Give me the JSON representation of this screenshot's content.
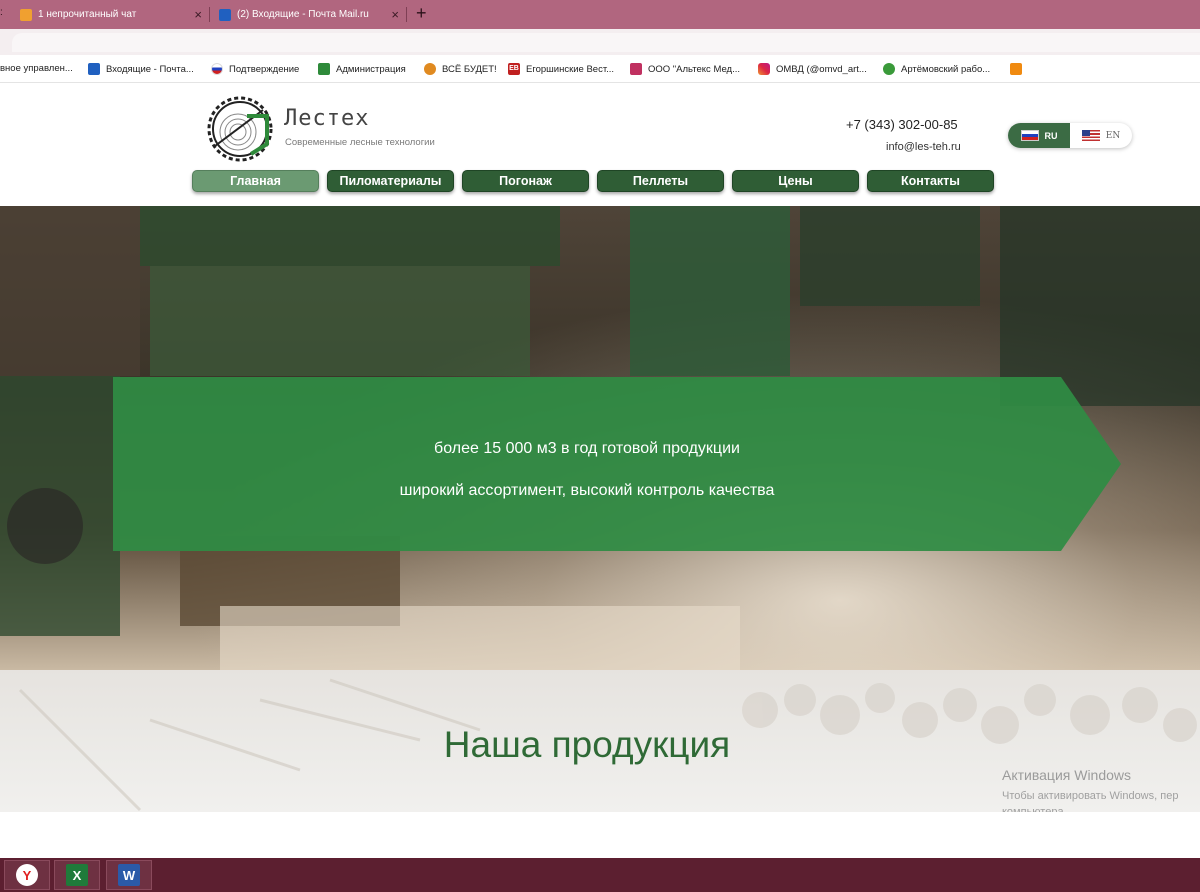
{
  "browser": {
    "cut_tab_glyph": ":",
    "tabs": [
      {
        "title": "1 непрочитанный чат",
        "icon": "mail-orange-icon",
        "color": "#f0a030"
      },
      {
        "title": "(2) Входящие - Почта Mail.ru",
        "icon": "mail-blue-icon",
        "color": "#2060c0"
      }
    ],
    "close_glyph": "×",
    "new_tab_glyph": "+",
    "bookmarks": [
      {
        "label": "вное управлен...",
        "icon": ""
      },
      {
        "label": "Входящие - Почта...",
        "icon": "mail-icon",
        "color": "#2060c0"
      },
      {
        "label": "Подтверждение",
        "icon": "russia-icon",
        "color": "#d02020"
      },
      {
        "label": "Администрация",
        "icon": "shield-icon",
        "color": "#2e8a3a"
      },
      {
        "label": "ВСЁ БУДЕТ!",
        "icon": "coin-icon",
        "color": "#e08a20"
      },
      {
        "label": "Егоршинские Вест...",
        "icon": "eb-icon",
        "color": "#c02020",
        "text": "EB"
      },
      {
        "label": "ООО \"Альтекс Мед...",
        "icon": "med-icon",
        "color": "#c03060"
      },
      {
        "label": "ОМВД (@omvd_art...",
        "icon": "instagram-icon",
        "color": "#c13584"
      },
      {
        "label": "Артёмовский рабо...",
        "icon": "leaf-icon",
        "color": "#3a9a3a"
      },
      {
        "label": "",
        "icon": "ok-icon",
        "color": "#f08a10"
      }
    ]
  },
  "site": {
    "logo_title": "Лестех",
    "logo_subtitle": "Современные лесные технологии",
    "phone": "+7 (343) 302-00-85",
    "email": "info@les-teh.ru",
    "lang": {
      "ru": "RU",
      "en": "EN"
    },
    "nav": [
      "Главная",
      "Пиломатериалы",
      "Погонаж",
      "Пеллеты",
      "Цены",
      "Контакты"
    ],
    "hero": {
      "line1": "более 15 000 м3 в год готовой продукции",
      "line2": "широкий ассортимент, высокий контроль качества",
      "banner_color": "#2f8c44"
    },
    "products_title": "Наша продукция"
  },
  "windows": {
    "activation_title": "Активация Windows",
    "activation_line1": "Чтобы активировать Windows, пер",
    "activation_line2": "компьютера."
  },
  "taskbar": [
    {
      "name": "yandex-browser-icon",
      "glyph": "Y",
      "color": "#e02020"
    },
    {
      "name": "excel-icon",
      "glyph": "X",
      "color": "#1f7a3a"
    },
    {
      "name": "word-icon",
      "glyph": "W",
      "color": "#2a5aa8"
    }
  ]
}
